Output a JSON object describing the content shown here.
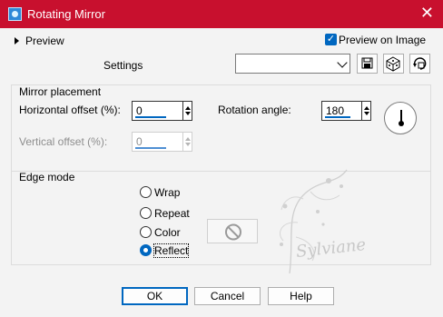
{
  "window": {
    "title": "Rotating Mirror",
    "close_glyph": "✕"
  },
  "preview": {
    "label": "Preview",
    "preview_on_image_label": "Preview on Image",
    "preview_on_image_checked": true
  },
  "settings": {
    "label": "Settings",
    "value": ""
  },
  "toolbar_icons": [
    "save-icon",
    "randomize-icon",
    "reset-icon"
  ],
  "mirror_placement": {
    "heading": "Mirror placement",
    "horizontal_offset_label": "Horizontal offset (%):",
    "horizontal_offset_value": "0",
    "vertical_offset_label": "Vertical offset (%):",
    "vertical_offset_value": "0",
    "rotation_angle_label": "Rotation angle:",
    "rotation_angle_value": "180"
  },
  "edge_mode": {
    "heading": "Edge mode",
    "options": [
      "Wrap",
      "Repeat",
      "Color",
      "Reflect"
    ],
    "selected": "Reflect"
  },
  "watermark": {
    "text": "Sylviane"
  },
  "buttons": {
    "ok": "OK",
    "cancel": "Cancel",
    "help": "Help"
  },
  "colors": {
    "title_bar": "#c8102e",
    "accent": "#0067c0",
    "panel": "#f3f3f3"
  }
}
